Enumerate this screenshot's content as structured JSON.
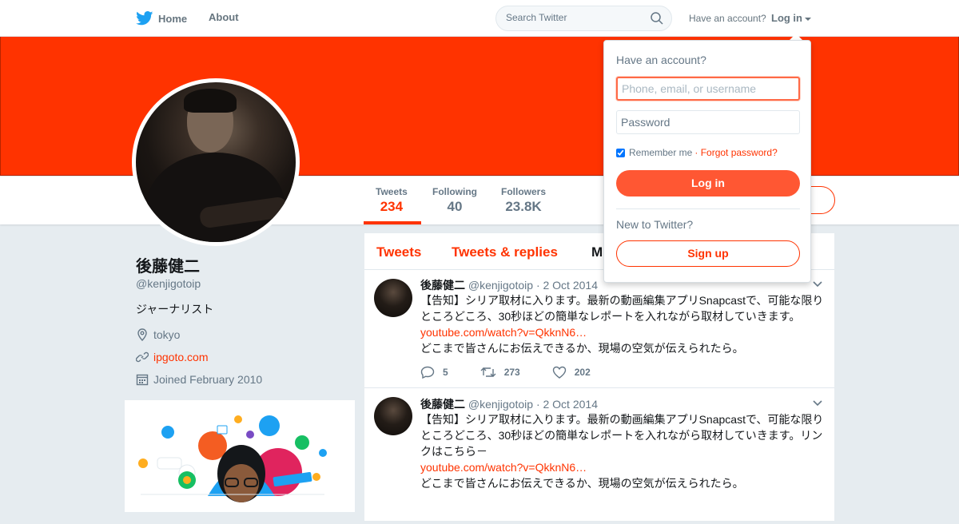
{
  "topbar": {
    "home_label": "Home",
    "about_label": "About",
    "search_placeholder": "Search Twitter",
    "have_account": "Have an account?",
    "login_label": "Log in"
  },
  "colors": {
    "accent": "#ff3300",
    "banner": "#ff3300",
    "bird": "#1da1f2"
  },
  "profile": {
    "name": "後藤健二",
    "handle": "@kenjigotoip",
    "bio": "ジャーナリスト",
    "location": "tokyo",
    "website": "ipgoto.com",
    "joined": "Joined February 2010"
  },
  "stats": [
    {
      "label": "Tweets",
      "value": "234"
    },
    {
      "label": "Following",
      "value": "40"
    },
    {
      "label": "Followers",
      "value": "23.8K"
    }
  ],
  "stream": {
    "tabs": [
      "Tweets",
      "Tweets & replies",
      "M"
    ]
  },
  "tweets": [
    {
      "name": "後藤健二",
      "handle": "@kenjigotoip",
      "date": "· 2 Oct 2014",
      "text1": "【告知】シリア取材に入ります。最新の動画編集アプリSnapcastで、可能な限りところどころ、30秒ほどの簡単なレポートを入れながら取材していきます。",
      "link": "youtube.com/watch?v=QkknN6…",
      "text2": "どこまで皆さんにお伝えできるか、現場の空気が伝えられたら。",
      "replies": "5",
      "retweets": "273",
      "likes": "202"
    },
    {
      "name": "後藤健二",
      "handle": "@kenjigotoip",
      "date": "· 2 Oct 2014",
      "text1": "【告知】シリア取材に入ります。最新の動画編集アプリSnapcastで、可能な限りところどころ、30秒ほどの簡単なレポートを入れながら取材していきます。リンクはこちら－",
      "link": "youtube.com/watch?v=QkknN6…",
      "text2": "どこまで皆さんにお伝えできるか、現場の空気が伝えられたら。"
    }
  ],
  "login_dropdown": {
    "title": "Have an account?",
    "username_placeholder": "Phone, email, or username",
    "password_placeholder": "Password",
    "remember_label": "Remember me",
    "forgot_label": "· Forgot password?",
    "login_button": "Log in",
    "new_label": "New to Twitter?",
    "signup_button": "Sign up"
  }
}
